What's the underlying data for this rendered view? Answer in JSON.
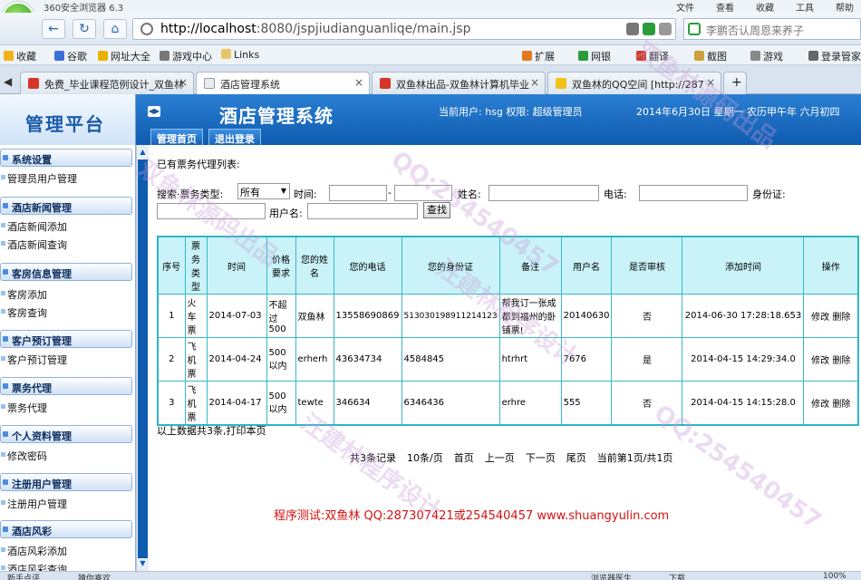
{
  "browser": {
    "window_title": "360安全浏览器 6.3",
    "menu": [
      "文件",
      "查看",
      "收藏",
      "工具",
      "帮助"
    ],
    "logo_letter": "e",
    "address_url_host": "http://localhost",
    "address_url_rest": ":8080/jspjiudianguanliqe/main.jsp",
    "search_text": "李鹏否认周恩来养子",
    "favorites": [
      "收藏",
      "谷歌",
      "网址大全",
      "游戏中心",
      "Links"
    ],
    "right_tools": [
      "扩展",
      "网银",
      "翻译",
      "截图",
      "游戏",
      "登录管家"
    ],
    "tabs": [
      {
        "label": "免费_毕业课程范例设计_双鱼林",
        "active": false
      },
      {
        "label": "酒店管理系统",
        "active": true
      },
      {
        "label": "双鱼林出品-双鱼林计算机毕业",
        "active": false
      },
      {
        "label": "双鱼林的QQ空间 [http://287",
        "active": false
      }
    ],
    "tab_close": "×",
    "tab_new": "+"
  },
  "app": {
    "brand": "管理平台",
    "system_name": "酒店管理系统",
    "user_info": "当前用户: hsg 权限: 超级管理员",
    "datetime": "2014年6月30日 星期一 农历甲午年 六月初四",
    "header_buttons": [
      "管理首页",
      "退出登录"
    ]
  },
  "sidebar": {
    "groups": [
      {
        "title": "系统设置",
        "items": [
          "管理员用户管理"
        ]
      },
      {
        "title": "酒店新闻管理",
        "items": [
          "酒店新闻添加",
          "酒店新闻查询"
        ]
      },
      {
        "title": "客房信息管理",
        "items": [
          "客房添加",
          "客房查询"
        ]
      },
      {
        "title": "客户预订管理",
        "items": [
          "客户预订管理"
        ]
      },
      {
        "title": "票务代理",
        "items": [
          "票务代理"
        ]
      },
      {
        "title": "个人资料管理",
        "items": [
          "修改密码"
        ]
      },
      {
        "title": "注册用户管理",
        "items": [
          "注册用户管理"
        ]
      },
      {
        "title": "酒店风彩",
        "items": [
          "酒店风彩添加",
          "酒店风彩查询"
        ]
      }
    ]
  },
  "main": {
    "list_title": "已有票务代理列表:",
    "search": {
      "label_type": "搜索·票务类型:",
      "type_value": "所有",
      "label_time": "时间:",
      "time_sep": "-",
      "label_name": "姓名:",
      "label_phone": "电话:",
      "label_idcard": "身份证:",
      "label_username": "用户名:",
      "button": "查找"
    },
    "table": {
      "headers": [
        "序号",
        "票务类型",
        "时间",
        "价格要求",
        "您的姓名",
        "您的电话",
        "您的身份证",
        "备注",
        "用户名",
        "是否审核",
        "添加时间",
        "操作"
      ],
      "rows": [
        [
          "1",
          "火车票",
          "2014-07-03",
          "不超过500",
          "双鱼林",
          "13558690869",
          "513030198911214123",
          "帮我订一张成都到福州的卧铺票!",
          "20140630",
          "否",
          "2014-06-30 17:28:18.653"
        ],
        [
          "2",
          "飞机票",
          "2014-04-24",
          "500以内",
          "erherh",
          "43634734",
          "4584845",
          "htrhrt",
          "7676",
          "是",
          "2014-04-15 14:29:34.0"
        ],
        [
          "3",
          "飞机票",
          "2014-04-17",
          "500以内",
          "tewte",
          "346634",
          "6346436",
          "erhre",
          "555",
          "否",
          "2014-04-15 14:15:28.0"
        ]
      ],
      "action_edit": "修改",
      "action_delete": "删除"
    },
    "summary": "以上数据共3条,打印本页",
    "pager": [
      "共3条记录",
      "10条/页",
      "首页",
      "上一页",
      "下一页",
      "尾页",
      "当前第1页/共1页"
    ],
    "footer_note": "程序测试:双鱼林 QQ:287307421或254540457 www.shuangyulin.com"
  },
  "statusbar": {
    "left": "新手点评",
    "left2": "猜你喜欢",
    "right": "浏览器医生",
    "right2": "下载",
    "zoom": "100%"
  },
  "watermarks": [
    "QQ:254540457",
    "汪建林程序设计",
    "双鱼林源码出品",
    "QQ:254540457",
    "汪建林程序设计",
    "双鱼林源码出品"
  ],
  "colors": {
    "header_blue": "#0f5bb0",
    "table_border": "#2fb5c5",
    "table_head": "#c9f3f8",
    "footer_red": "#d41212"
  }
}
